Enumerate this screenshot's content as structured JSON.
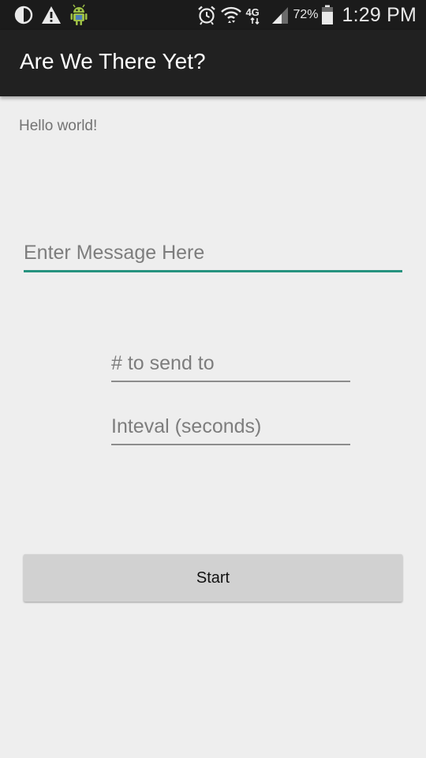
{
  "status_bar": {
    "left_icons": [
      "half-moon-icon",
      "warning-icon",
      "android-icon"
    ],
    "right_icons": [
      "alarm-icon",
      "wifi-icon",
      "network-4g-icon",
      "signal-icon",
      "battery-icon"
    ],
    "network_label": "4G",
    "battery_percent": "72%",
    "time": "1:29 PM"
  },
  "app_bar": {
    "title": "Are We There Yet?"
  },
  "main": {
    "hello_text": "Hello world!",
    "message_input": {
      "placeholder": "Enter Message Here",
      "value": ""
    },
    "number_input": {
      "placeholder": "# to send to",
      "value": ""
    },
    "interval_input": {
      "placeholder": "Inteval (seconds)",
      "value": ""
    },
    "start_button_label": "Start"
  },
  "colors": {
    "status_bar_bg": "#1b1b1b",
    "app_bar_bg": "#212121",
    "background": "#eeeeee",
    "accent": "#26937f",
    "button_bg": "#d1d1d1"
  }
}
